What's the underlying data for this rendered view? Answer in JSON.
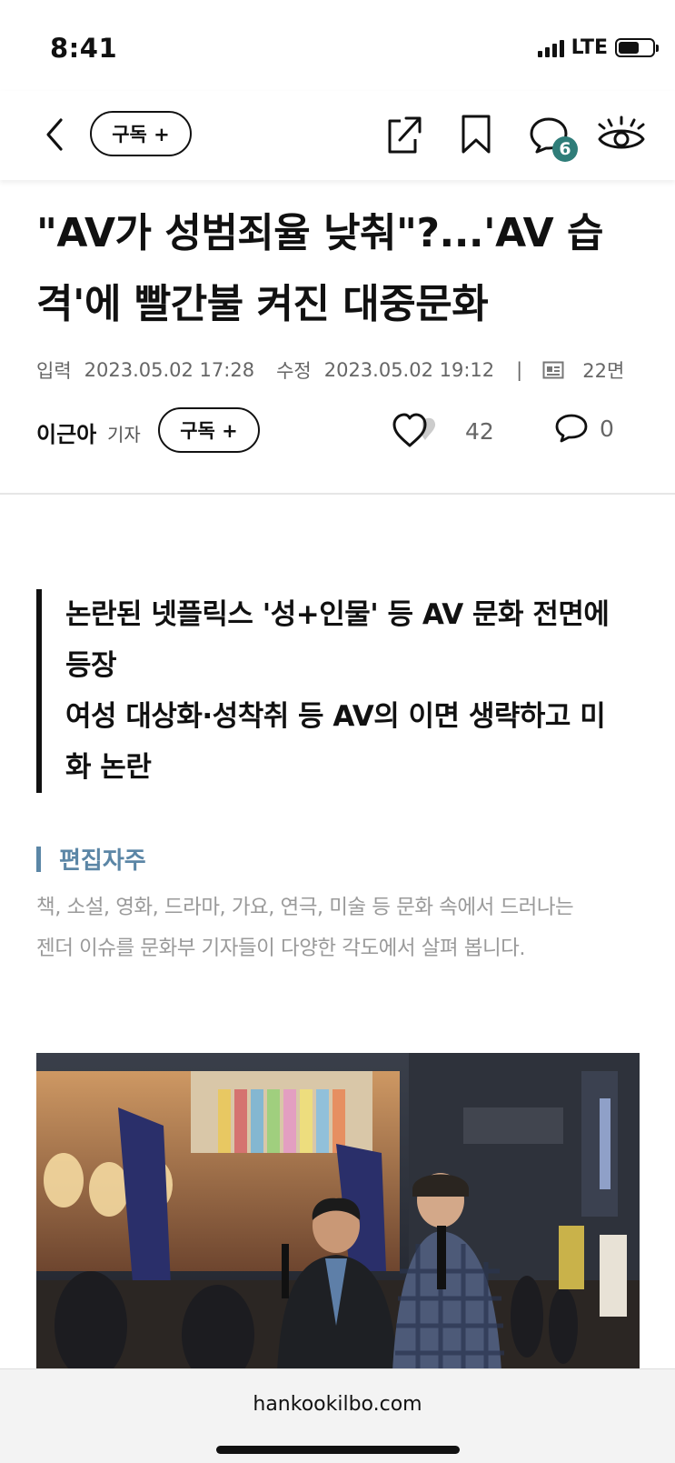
{
  "status_bar": {
    "time": "8:41",
    "network": "LTE"
  },
  "nav": {
    "subscribe_label": "구독 +",
    "comment_badge": "6"
  },
  "article": {
    "headline_line1": "\"AV가 성범죄율 낮춰\"?...'AV 습",
    "headline_line2": "격'에 빨간불 켜진 대중문화",
    "input_label": "입력",
    "input_date": "2023.05.02 17:28",
    "edit_label": "수정",
    "edit_date": "2023.05.02 19:12",
    "separator": "|",
    "page": "22면",
    "author_name": "이근아",
    "author_role": "기자",
    "author_subscribe_label": "구독 +",
    "like_count": "42",
    "comment_count": "0",
    "summary_line1": "논란된 넷플릭스 '성+인물' 등 AV 문화 전면에",
    "summary_line2": "등장",
    "summary_line3": "여성 대상화·성착취 등 AV의 이면 생략하고 미",
    "summary_line4": "화 논란",
    "note_title": "편집자주",
    "note_line1": "책, 소설, 영화, 드라마, 가요, 연극, 미술 등 문화 속에서 드러나는",
    "note_line2": "젠더 이슈를 문화부 기자들이 다양한 각도에서 살펴 봅니다."
  },
  "browser": {
    "url": "hankookilbo.com"
  },
  "colors": {
    "accent_teal": "#2f7d79",
    "note_blue": "#5b86a6",
    "meta_gray": "#666666"
  }
}
